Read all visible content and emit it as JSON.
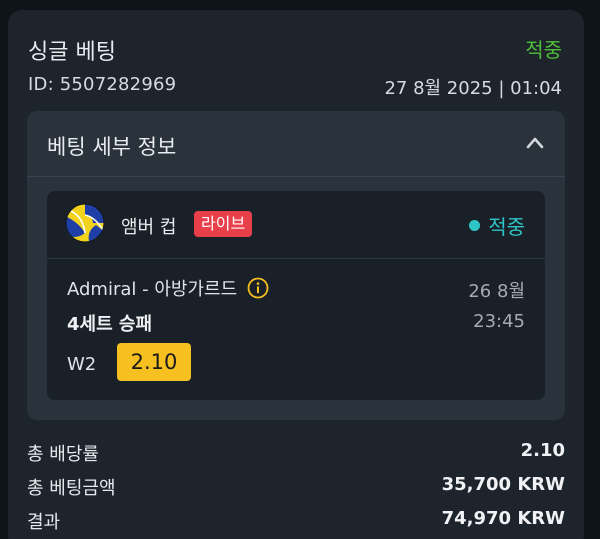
{
  "bet": {
    "title": "싱글 베팅",
    "status": "적중",
    "id": "ID: 5507282969",
    "date": "27 8월 2025 | 01:04"
  },
  "details": {
    "title": "베팅 세부 정보",
    "event": {
      "league": "앰버 컵",
      "live_label": "라이브",
      "status": "적중",
      "teams": "Admiral - 아방가르드",
      "day": "26 8월",
      "time": "23:45",
      "market": "4세트 승패",
      "pick": "W2",
      "odds": "2.10"
    }
  },
  "summary": {
    "total_odds_label": "총 배당률",
    "total_odds_value": "2.10",
    "stake_label": "총 베팅금액",
    "stake_value": "35,700 KRW",
    "result_label": "결과",
    "result_value": "74,970 KRW"
  },
  "icons": {
    "sport": "volleyball-icon",
    "collapse": "chevron-up-icon",
    "info": "info-icon"
  },
  "colors": {
    "won": "#4fbf3a",
    "event_won": "#2fc5c8",
    "live_badge": "#e8404b",
    "odds_box": "#f6c021"
  }
}
